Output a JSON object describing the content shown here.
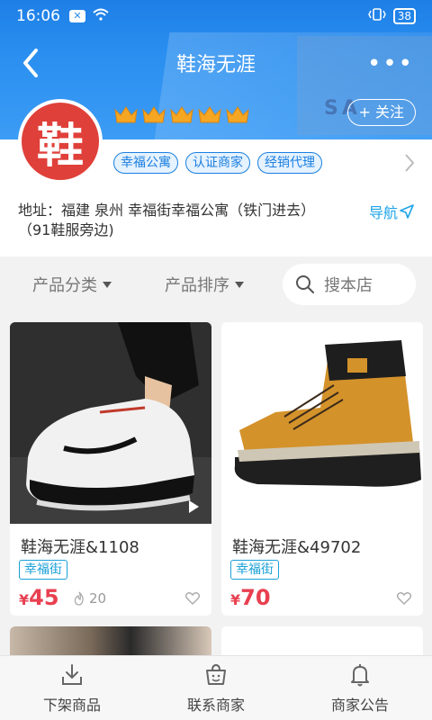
{
  "status_bar": {
    "time": "16:06",
    "battery": "38"
  },
  "header": {
    "title": "鞋海无涯",
    "back_icon": "back-arrow-icon",
    "more_icon": "more-dots-icon"
  },
  "store": {
    "logo_char": "鞋",
    "crown_count": 5,
    "follow_label": "+ 关注",
    "tags": [
      "幸福公寓",
      "认证商家",
      "经销代理"
    ],
    "address_line1": "地址：福建 泉州 幸福街幸福公寓（铁门进去）",
    "address_line2": "（91鞋服旁边)",
    "nav_label": "导航"
  },
  "filters": {
    "category_label": "产品分类",
    "sort_label": "产品排序",
    "search_placeholder": "搜本店"
  },
  "products": [
    {
      "name": "鞋海无涯&1108",
      "badge": "幸福街",
      "currency": "¥",
      "price": "45",
      "likes": "20"
    },
    {
      "name": "鞋海无涯&49702",
      "badge": "幸福街",
      "currency": "¥",
      "price": "70"
    }
  ],
  "tabbar": {
    "items": [
      {
        "label": "下架商品",
        "icon": "download-tray-icon"
      },
      {
        "label": "联系商家",
        "icon": "contact-bag-icon"
      },
      {
        "label": "商家公告",
        "icon": "bell-icon"
      }
    ]
  },
  "colors": {
    "brand_blue": "#2a8ff0",
    "price_red": "#e84050",
    "logo_red": "#e0403a"
  }
}
